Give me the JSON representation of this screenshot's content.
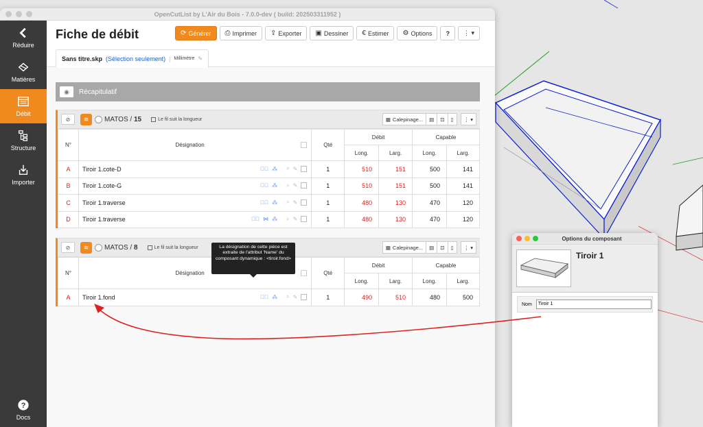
{
  "app": {
    "window_title": "OpenCutList by L'Air du Bois - 7.0.0-dev ( build: 202503311952 )",
    "page_title": "Fiche de débit",
    "accent_color": "#f08a1e"
  },
  "sidebar": {
    "items": [
      {
        "label": "Réduire",
        "icon": "chevron-left-icon"
      },
      {
        "label": "Matières",
        "icon": "materials-icon"
      },
      {
        "label": "Débit",
        "icon": "cutlist-icon",
        "active": true
      },
      {
        "label": "Structure",
        "icon": "structure-icon"
      },
      {
        "label": "Importer",
        "icon": "import-icon"
      }
    ],
    "docs_label": "Docs"
  },
  "toolbar": {
    "generate": "Générer",
    "print": "Imprimer",
    "export": "Exporter",
    "draw": "Dessiner",
    "estimate": "Estimer",
    "options": "Options",
    "help": "?",
    "more": "⋮ ▾"
  },
  "file_tab": {
    "filename": "Sans titre.skp",
    "selection": "(Sélection seulement)",
    "unit": "Millimètre"
  },
  "summary": {
    "label": "Récapitulatif"
  },
  "columns": {
    "number": "N°",
    "designation": "Désignation",
    "qty": "Qté",
    "cut": "Débit",
    "capable": "Capable",
    "length": "Long.",
    "width": "Larg."
  },
  "groups": [
    {
      "material": "MATOS",
      "thickness": "15",
      "grain": "Le fil suit la longueur",
      "calepinage": "Calepinage...",
      "rows": [
        {
          "letter": "A",
          "name": "Tiroir 1.cote-D",
          "qty": "1",
          "cut_length": "510",
          "cut_width": "151",
          "length": "500",
          "width": "141"
        },
        {
          "letter": "B",
          "name": "Tiroir 1.cote-G",
          "qty": "1",
          "cut_length": "510",
          "cut_width": "151",
          "length": "500",
          "width": "141"
        },
        {
          "letter": "C",
          "name": "Tiroir 1.traverse",
          "qty": "1",
          "cut_length": "480",
          "cut_width": "130",
          "length": "470",
          "width": "120"
        },
        {
          "letter": "D",
          "name": "Tiroir 1.traverse",
          "qty": "1",
          "cut_length": "480",
          "cut_width": "130",
          "length": "470",
          "width": "120"
        }
      ]
    },
    {
      "material": "MATOS",
      "thickness": "8",
      "grain": "Le fil suit la longueur",
      "calepinage": "Calepinage...",
      "rows": [
        {
          "letter": "A",
          "name": "Tiroir 1.fond",
          "qty": "1",
          "cut_length": "490",
          "cut_width": "510",
          "length": "480",
          "width": "500"
        }
      ]
    }
  ],
  "tooltip": {
    "text": "La désignation de cette pièce est extraite de l'attribut 'Name' du composant dynamique : <tiroir.fond>"
  },
  "options_window": {
    "title": "Options du composant",
    "component_name": "Tiroir 1",
    "field_label": "Nom",
    "field_value": "Tiroir 1"
  }
}
